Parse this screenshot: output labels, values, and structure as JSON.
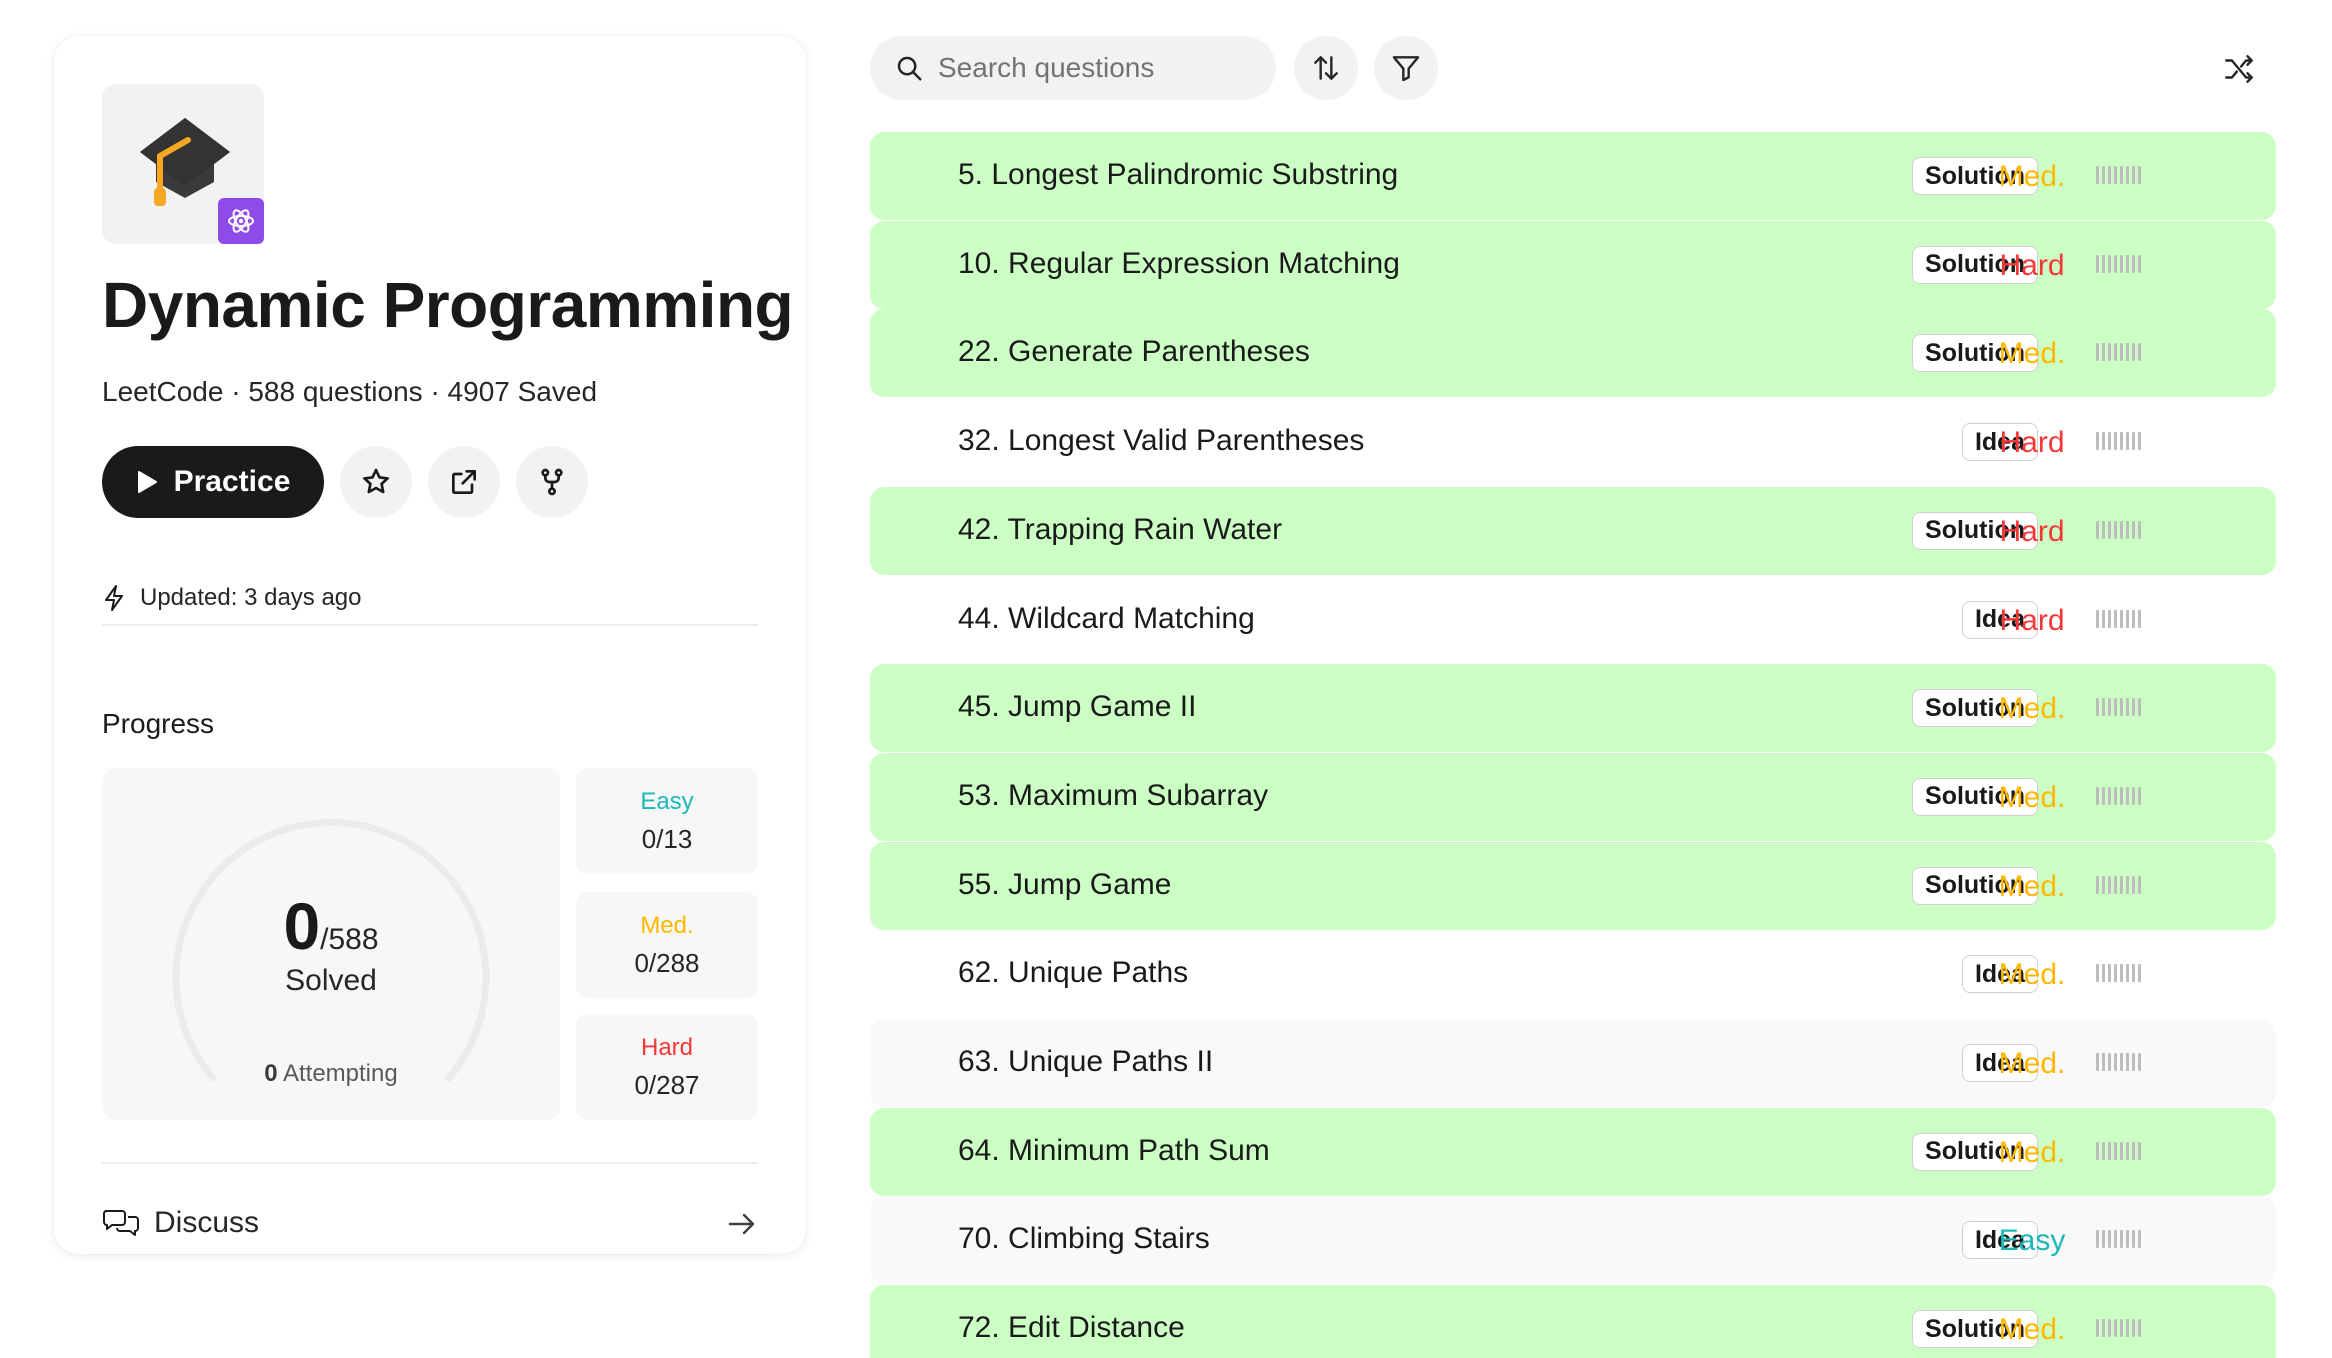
{
  "card": {
    "title": "Dynamic Programming",
    "meta": "LeetCode · 588 questions · 4907 Saved",
    "practice_label": "Practice",
    "updated": "Updated: 3 days ago",
    "progress_title": "Progress",
    "solved": "0",
    "total": "/588",
    "solved_label": "Solved",
    "attempting_count": "0",
    "attempting_label": " Attempting",
    "difficulty": {
      "easy": {
        "label": "Easy",
        "value": "0/13"
      },
      "med": {
        "label": "Med.",
        "value": "0/288"
      },
      "hard": {
        "label": "Hard",
        "value": "0/287"
      }
    },
    "discuss_label": "Discuss"
  },
  "search": {
    "placeholder": "Search questions"
  },
  "colors": {
    "solution_row": "#ccffc4",
    "easy": "#1cb8b8",
    "med": "#ffb700",
    "hard": "#f63737",
    "badge": "#8f4bea"
  },
  "questions": [
    {
      "name": "5. Longest Palindromic Substring",
      "tag": "Solution",
      "difficulty": "Med."
    },
    {
      "name": "10. Regular Expression Matching",
      "tag": "Solution",
      "difficulty": "Hard"
    },
    {
      "name": "22. Generate Parentheses",
      "tag": "Solution",
      "difficulty": "Med."
    },
    {
      "name": "32. Longest Valid Parentheses",
      "tag": "Idea",
      "difficulty": "Hard"
    },
    {
      "name": "42. Trapping Rain Water",
      "tag": "Solution",
      "difficulty": "Hard"
    },
    {
      "name": "44. Wildcard Matching",
      "tag": "Idea",
      "difficulty": "Hard"
    },
    {
      "name": "45. Jump Game II",
      "tag": "Solution",
      "difficulty": "Med."
    },
    {
      "name": "53. Maximum Subarray",
      "tag": "Solution",
      "difficulty": "Med."
    },
    {
      "name": "55. Jump Game",
      "tag": "Solution",
      "difficulty": "Med."
    },
    {
      "name": "62. Unique Paths",
      "tag": "Idea",
      "difficulty": "Med."
    },
    {
      "name": "63. Unique Paths II",
      "tag": "Idea",
      "difficulty": "Med."
    },
    {
      "name": "64. Minimum Path Sum",
      "tag": "Solution",
      "difficulty": "Med."
    },
    {
      "name": "70. Climbing Stairs",
      "tag": "Idea",
      "difficulty": "Easy"
    },
    {
      "name": "72. Edit Distance",
      "tag": "Solution",
      "difficulty": "Med."
    }
  ]
}
